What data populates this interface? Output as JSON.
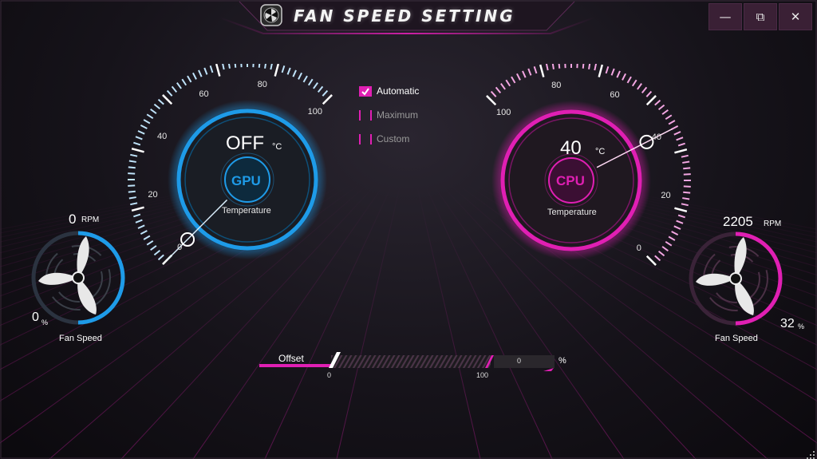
{
  "title": "FAN SPEED SETTING",
  "window_controls": {
    "minimize": "—",
    "maximize": "⧉",
    "close": "✕"
  },
  "modes": [
    {
      "label": "Automatic",
      "checked": true
    },
    {
      "label": "Maximum",
      "checked": false
    },
    {
      "label": "Custom",
      "checked": false
    }
  ],
  "gpu": {
    "chip_label": "GPU",
    "temperature_value": "OFF",
    "temperature_unit": "°C",
    "temperature_label": "Temperature",
    "scale_ticks": [
      "0",
      "20",
      "40",
      "60",
      "80",
      "100"
    ],
    "needle_value": 0,
    "accent": "#1e9be8",
    "fan": {
      "rpm_value": "0",
      "rpm_unit": "RPM",
      "speed_value": "0",
      "speed_unit": "%",
      "label": "Fan Speed",
      "ring_fraction": 0.5
    }
  },
  "cpu": {
    "chip_label": "CPU",
    "temperature_value": "40",
    "temperature_unit": "°C",
    "temperature_label": "Temperature",
    "scale_ticks": [
      "0",
      "20",
      "40",
      "60",
      "80",
      "100"
    ],
    "needle_value": 40,
    "accent": "#e01fb3",
    "fan": {
      "rpm_value": "2205",
      "rpm_unit": "RPM",
      "speed_value": "32",
      "speed_unit": "%",
      "label": "Fan Speed",
      "ring_fraction": 0.5
    }
  },
  "offset": {
    "label": "Offset",
    "min_label": "0",
    "max_label": "100",
    "value": "0",
    "unit": "%"
  }
}
